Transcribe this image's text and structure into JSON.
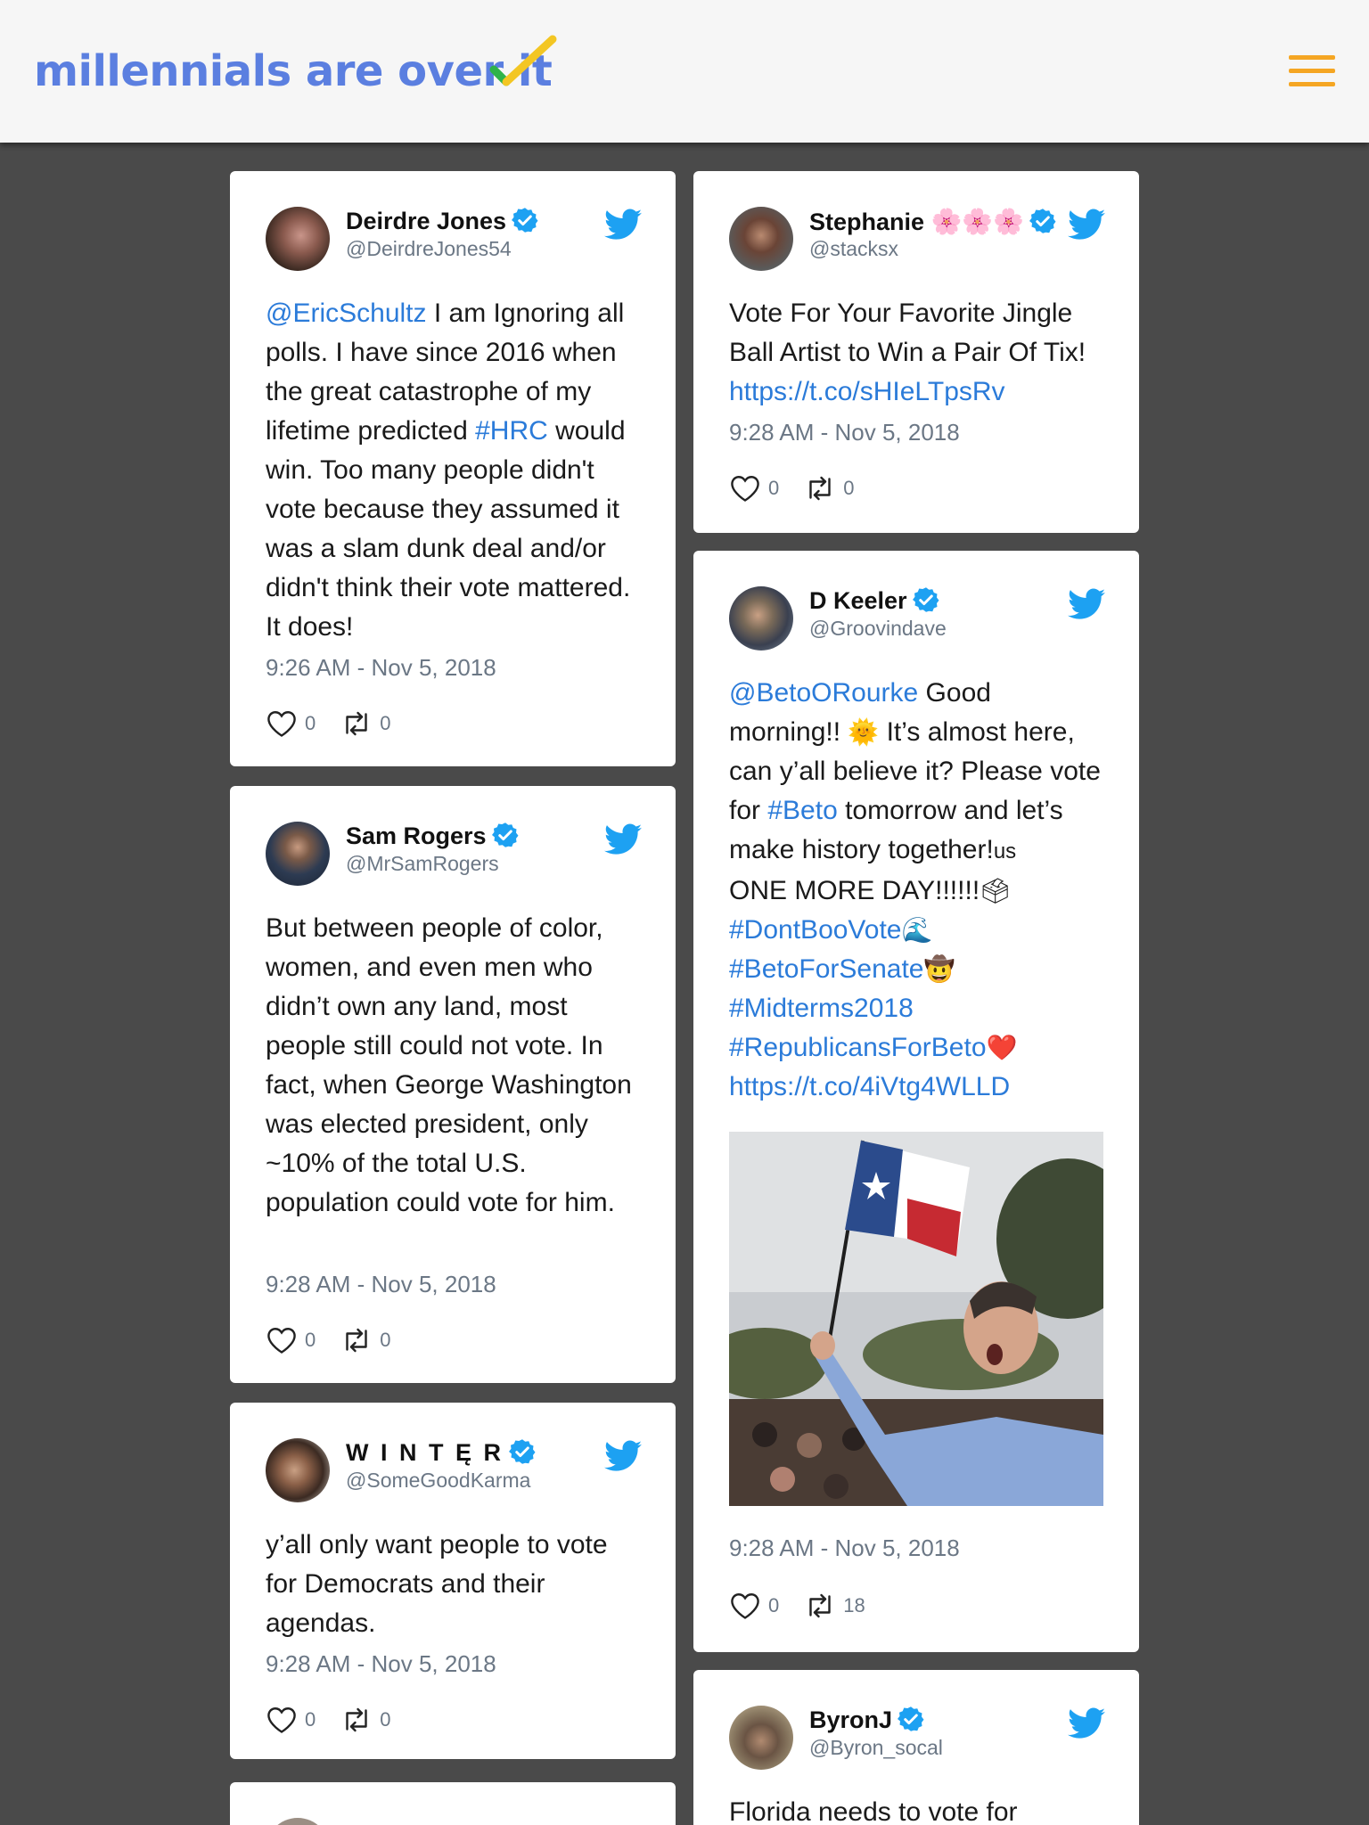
{
  "header": {
    "title": "millennials are over it"
  },
  "icons": {
    "brand_check": "check-icon",
    "menu": "menu-icon",
    "verified": "verified-icon",
    "twitter": "twitter-bird-icon",
    "like": "heart-icon",
    "retweet": "retweet-icon"
  },
  "colors": {
    "brand": "#5b7fe0",
    "menu": "#f5a623",
    "link": "#2b7bd9",
    "twitter_blue": "#1da1f2",
    "background": "#4a4a4a"
  },
  "tweets": [
    {
      "name": "Deirdre Jones",
      "handle": "@DeirdreJones54",
      "link1": "@EricSchultz",
      "text1": " I am Ignoring all polls. I have since 2016 when the great catastrophe of my lifetime predicted ",
      "link2": "#HRC",
      "text2": " would win. Too many people didn't vote because they assumed it was a slam dunk deal and/or didn't think their vote mattered. It does!",
      "time": "9:26 AM - Nov 5, 2018",
      "likes": "0",
      "retweets": "0"
    },
    {
      "name": "Sam Rogers",
      "handle": "@MrSamRogers",
      "text": "But between people of color, women, and even men who didn’t own any land, most people still could not vote. In fact, when George Washington was elected president, only ~10% of the total U.S. population could vote for him.",
      "time": "9:28 AM - Nov 5, 2018",
      "likes": "0",
      "retweets": "0"
    },
    {
      "name": "W I N T Ę R",
      "handle": "@SomeGoodKarma",
      "text": "y’all only want people to vote for Democrats and their agendas.",
      "time": "9:28 AM - Nov 5, 2018",
      "likes": "0",
      "retweets": "0"
    },
    {
      "name": "Stephanie",
      "name_emoji": "🌸🌸🌸",
      "handle": "@stacksx",
      "text1": "Vote For Your Favorite Jingle Ball Artist to Win a Pair Of Tix! ",
      "link1": "https://t.co/sHIeLTpsRv",
      "time": "9:28 AM - Nov 5, 2018",
      "likes": "0",
      "retweets": "0"
    },
    {
      "name": "D Keeler",
      "handle": "@Groovindave",
      "link1": "@BetoORourke",
      "text1": " Good morning!! ",
      "emoji1": "🌞",
      "text2": " It’s almost here, can y’all believe it? Please vote for ",
      "link2": "#Beto",
      "text3": " tomorrow and let’s make history together!",
      "emoji2": "us",
      "text4": "ONE MORE DAY!!!!!!",
      "emoji3": "🗳",
      "link3": "#DontBooVote",
      "emoji4": "🌊",
      "link4": "#BetoForSenate",
      "emoji5": "🤠",
      "link5": "#Midterms2018",
      "link6": "#RepublicansForBeto",
      "emoji6": "❤️",
      "link7": "https://t.co/4iVtg4WLLD",
      "time": "9:28 AM - Nov 5, 2018",
      "likes": "0",
      "retweets": "18"
    },
    {
      "name": "ByronJ",
      "handle": "@Byron_socal",
      "text": "Florida needs to vote for"
    }
  ]
}
